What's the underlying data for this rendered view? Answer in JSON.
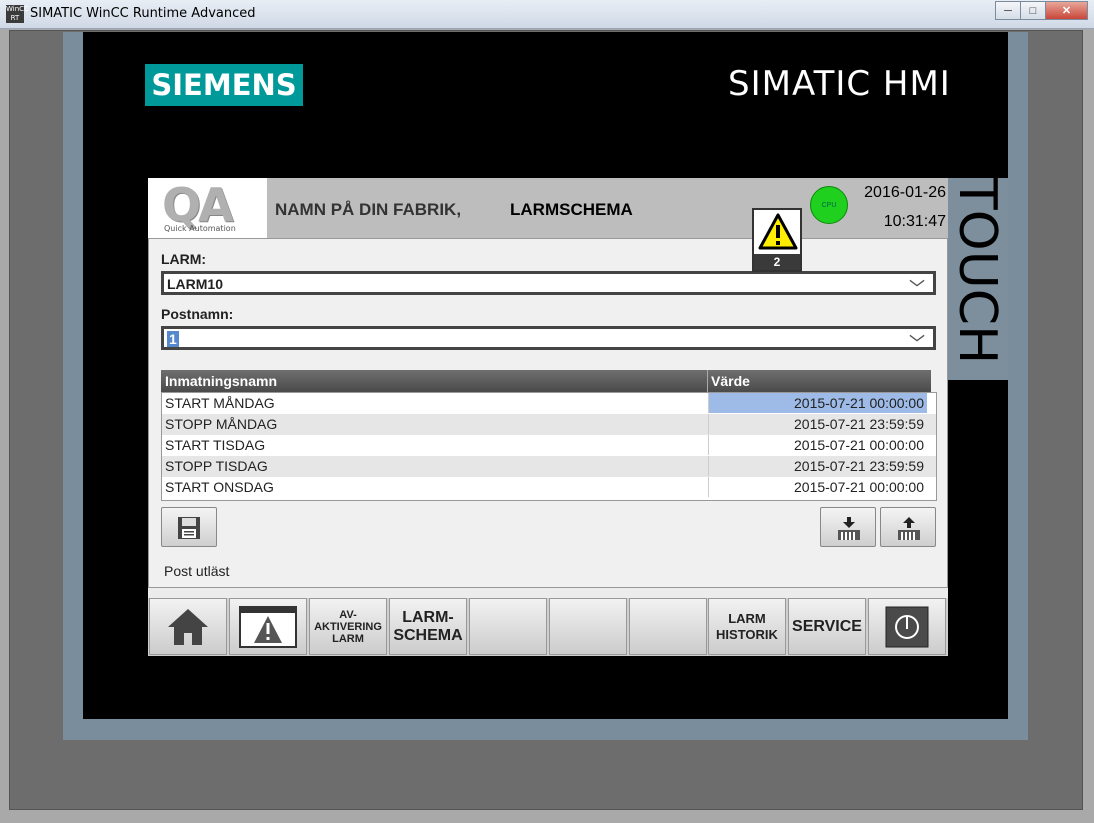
{
  "window": {
    "title": "SIMATIC WinCC Runtime Advanced",
    "logo_text": "WinCC RT",
    "minimize_icon": "minimize-icon",
    "maximize_icon": "maximize-icon",
    "close_icon": "close-icon"
  },
  "device": {
    "brand": "SIEMENS",
    "product": "SIMATIC HMI",
    "side_label": "TOUCH",
    "brand_color": "#009999"
  },
  "header": {
    "logo_letters": "QA",
    "logo_sub": "Quick Automation",
    "plant_name": "NAMN PÅ DIN FABRIK,",
    "screen_title": "LARMSCHEMA",
    "cpu_label": "CPU",
    "cpu_color": "#1fd01f",
    "date": "2016-01-26",
    "time": "10:31:47"
  },
  "alarm_indicator": {
    "icon": "warning-icon",
    "count": "2"
  },
  "form": {
    "larm_label": "LARM:",
    "larm_value": "LARM10",
    "post_label": "Postnamn:",
    "post_value": "1"
  },
  "table": {
    "columns": [
      "Inmatningsnamn",
      "Värde"
    ],
    "rows": [
      {
        "name": "START MÅNDAG",
        "value": "2015-07-21 00:00:00"
      },
      {
        "name": "STOPP MÅNDAG",
        "value": "2015-07-21 23:59:59"
      },
      {
        "name": "START TISDAG",
        "value": "2015-07-21 00:00:00"
      },
      {
        "name": "STOPP TISDAG",
        "value": "2015-07-21 23:59:59"
      },
      {
        "name": "START ONSDAG",
        "value": "2015-07-21 00:00:00"
      }
    ]
  },
  "actions": {
    "save_icon": "save-icon",
    "import_icon": "import-icon",
    "export_icon": "export-icon"
  },
  "status": "Post utläst",
  "nav": [
    {
      "id": "home",
      "icon": "home-icon"
    },
    {
      "id": "alarms",
      "icon": "alarm-window-icon"
    },
    {
      "id": "deactivation",
      "lines": [
        "AV-",
        "AKTIVERING",
        "LARM"
      ]
    },
    {
      "id": "schema",
      "lines": [
        "LARM-",
        "SCHEMA"
      ]
    },
    {
      "id": "empty1"
    },
    {
      "id": "empty2"
    },
    {
      "id": "empty3"
    },
    {
      "id": "history",
      "lines": [
        "LARM",
        "HISTORIK"
      ]
    },
    {
      "id": "service",
      "label": "SERVICE"
    },
    {
      "id": "power",
      "icon": "power-icon"
    }
  ]
}
